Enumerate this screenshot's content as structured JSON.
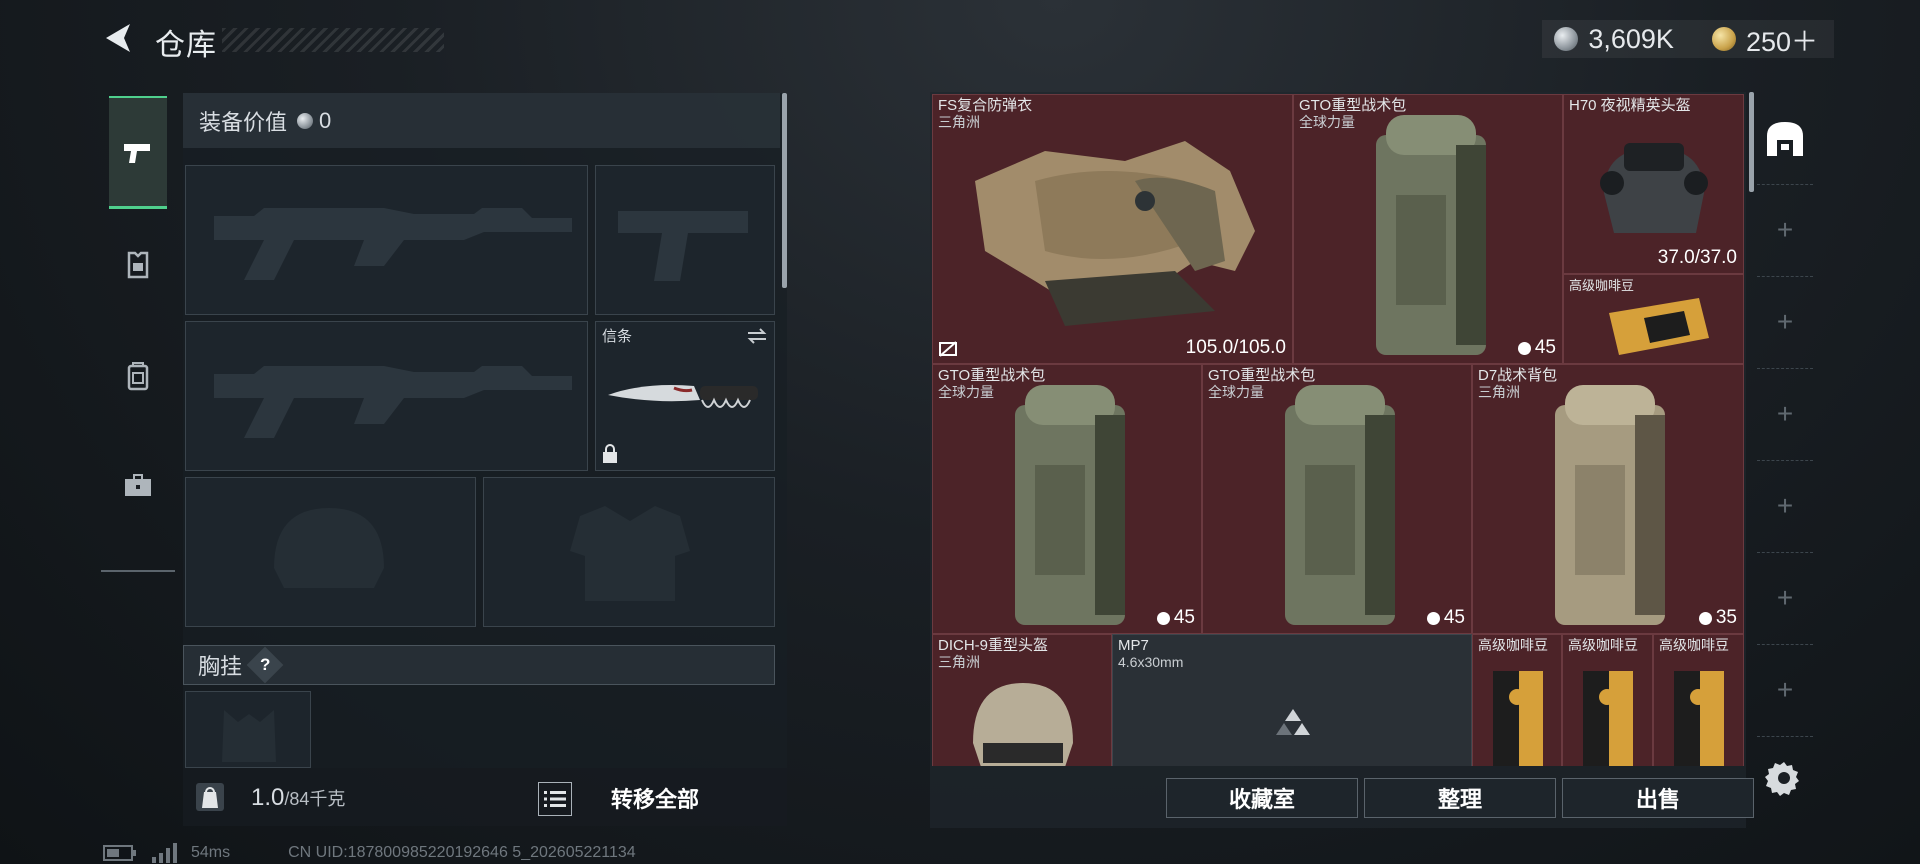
{
  "header": {
    "title": "仓库",
    "back_icon": "back-arrow-icon",
    "currencies": [
      {
        "icon": "silver-coin-icon",
        "value": "3,609K"
      },
      {
        "icon": "gold-coin-icon",
        "value": "250＋"
      }
    ]
  },
  "left_nav": {
    "items": [
      {
        "name": "weapons",
        "icon": "pistol-icon",
        "active": true
      },
      {
        "name": "armor",
        "icon": "armor-icon",
        "active": false
      },
      {
        "name": "backpack",
        "icon": "backpack-icon",
        "active": false
      },
      {
        "name": "case",
        "icon": "briefcase-icon",
        "active": false
      }
    ]
  },
  "equipment": {
    "value_label": "装备价值",
    "value": "0",
    "slots": {
      "primary1": "rifle-slot",
      "pistol": "pistol-slot",
      "primary2": "rifle-slot",
      "melee_label": "信条",
      "helmet": "helmet-slot",
      "armor": "armor-slot"
    },
    "chest_rig_label": "胸挂",
    "help": "?"
  },
  "weight": {
    "current": "1.0",
    "max": "/84千克"
  },
  "transfer_all": "转移全部",
  "status": {
    "ping": "54ms",
    "uid": "CN UID:187800985220192646 5_202605221134"
  },
  "warehouse": {
    "items": [
      {
        "name": "FS复合防弹衣",
        "sub": "三角洲",
        "value": "105.0/105.0",
        "kind": "vest"
      },
      {
        "name": "GTO重型战术包",
        "sub": "全球力量",
        "capacity": "45",
        "kind": "backpack"
      },
      {
        "name": "H70 夜视精英头盔",
        "sub": "",
        "value": "37.0/37.0",
        "kind": "nvhelmet"
      },
      {
        "name": "高级咖啡豆",
        "sub": "",
        "kind": "coffee"
      },
      {
        "name": "GTO重型战术包",
        "sub": "全球力量",
        "capacity": "45",
        "kind": "backpack"
      },
      {
        "name": "GTO重型战术包",
        "sub": "全球力量",
        "capacity": "45",
        "kind": "backpack"
      },
      {
        "name": "D7战术背包",
        "sub": "三角洲",
        "capacity": "35",
        "kind": "backpack-tan"
      },
      {
        "name": "DICH-9重型头盔",
        "sub": "三角洲",
        "kind": "helmet"
      },
      {
        "name": "MP7",
        "sub": "4.6x30mm",
        "kind": "smg"
      },
      {
        "name": "高级咖啡豆",
        "sub": "",
        "kind": "coffee"
      },
      {
        "name": "高级咖啡豆",
        "sub": "",
        "kind": "coffee"
      },
      {
        "name": "高级咖啡豆",
        "sub": "",
        "kind": "coffee"
      }
    ]
  },
  "warehouse_tabs": {
    "active_icon": "storage-icon",
    "add_symbol": "+"
  },
  "buttons": {
    "collection": "收藏室",
    "organize": "整理",
    "sell": "出售"
  },
  "colors": {
    "accent": "#4fd08d",
    "item_bg": "#4c2328",
    "panel": "#1d252c"
  }
}
